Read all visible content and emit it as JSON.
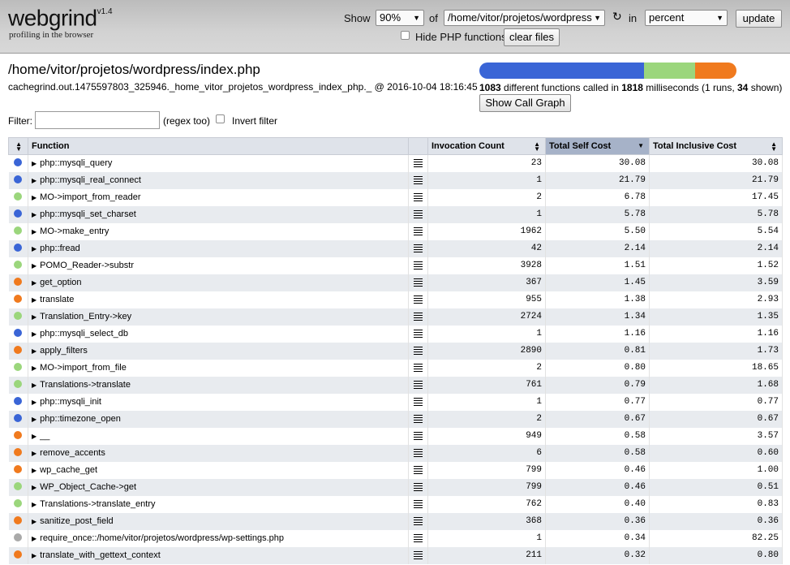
{
  "header": {
    "logo": "webgrind",
    "version": "v1.4",
    "tagline": "profiling in the browser",
    "show_label": "Show",
    "show_value": "90%",
    "of_label": "of",
    "file_value": "/home/vitor/projetos/wordpress",
    "in_label": "in",
    "unit_value": "percent",
    "update_label": "update",
    "hide_php_label": "Hide PHP functions",
    "clear_files_label": "clear files"
  },
  "summary": {
    "title": "/home/vitor/projetos/wordpress/index.php",
    "subtitle": "cachegrind.out.1475597803_325946._home_vitor_projetos_wordpress_index_php._ @ 2016-10-04 18:16:45",
    "progress": {
      "blue": 0.64,
      "green": 0.2,
      "orange": 0.16
    },
    "functions_count": "1083",
    "functions_text": " different functions called in ",
    "ms": "1818",
    "ms_text": " milliseconds (1 runs, ",
    "shown": "34",
    "shown_text": " shown)",
    "call_graph_label": "Show Call Graph"
  },
  "filter": {
    "label": "Filter:",
    "value": "",
    "regex_label": "(regex too)",
    "invert_label": "Invert filter"
  },
  "colors": {
    "blue": "#3a65d6",
    "green": "#9bd67c",
    "orange": "#f07a1e",
    "gray": "#a9a9a9"
  },
  "table": {
    "headers": {
      "function": "Function",
      "invocation": "Invocation Count",
      "self": "Total Self Cost",
      "inclusive": "Total Inclusive Cost"
    },
    "rows": [
      {
        "color": "#3a65d6",
        "name": "php::mysqli_query",
        "count": "23",
        "self": "30.08",
        "incl": "30.08"
      },
      {
        "color": "#3a65d6",
        "name": "php::mysqli_real_connect",
        "count": "1",
        "self": "21.79",
        "incl": "21.79"
      },
      {
        "color": "#9bd67c",
        "name": "MO->import_from_reader",
        "count": "2",
        "self": "6.78",
        "incl": "17.45"
      },
      {
        "color": "#3a65d6",
        "name": "php::mysqli_set_charset",
        "count": "1",
        "self": "5.78",
        "incl": "5.78"
      },
      {
        "color": "#9bd67c",
        "name": "MO->make_entry",
        "count": "1962",
        "self": "5.50",
        "incl": "5.54"
      },
      {
        "color": "#3a65d6",
        "name": "php::fread",
        "count": "42",
        "self": "2.14",
        "incl": "2.14"
      },
      {
        "color": "#9bd67c",
        "name": "POMO_Reader->substr",
        "count": "3928",
        "self": "1.51",
        "incl": "1.52"
      },
      {
        "color": "#f07a1e",
        "name": "get_option",
        "count": "367",
        "self": "1.45",
        "incl": "3.59"
      },
      {
        "color": "#f07a1e",
        "name": "translate",
        "count": "955",
        "self": "1.38",
        "incl": "2.93"
      },
      {
        "color": "#9bd67c",
        "name": "Translation_Entry->key",
        "count": "2724",
        "self": "1.34",
        "incl": "1.35"
      },
      {
        "color": "#3a65d6",
        "name": "php::mysqli_select_db",
        "count": "1",
        "self": "1.16",
        "incl": "1.16"
      },
      {
        "color": "#f07a1e",
        "name": "apply_filters",
        "count": "2890",
        "self": "0.81",
        "incl": "1.73"
      },
      {
        "color": "#9bd67c",
        "name": "MO->import_from_file",
        "count": "2",
        "self": "0.80",
        "incl": "18.65"
      },
      {
        "color": "#9bd67c",
        "name": "Translations->translate",
        "count": "761",
        "self": "0.79",
        "incl": "1.68"
      },
      {
        "color": "#3a65d6",
        "name": "php::mysqli_init",
        "count": "1",
        "self": "0.77",
        "incl": "0.77"
      },
      {
        "color": "#3a65d6",
        "name": "php::timezone_open",
        "count": "2",
        "self": "0.67",
        "incl": "0.67"
      },
      {
        "color": "#f07a1e",
        "name": "__",
        "count": "949",
        "self": "0.58",
        "incl": "3.57"
      },
      {
        "color": "#f07a1e",
        "name": "remove_accents",
        "count": "6",
        "self": "0.58",
        "incl": "0.60"
      },
      {
        "color": "#f07a1e",
        "name": "wp_cache_get",
        "count": "799",
        "self": "0.46",
        "incl": "1.00"
      },
      {
        "color": "#9bd67c",
        "name": "WP_Object_Cache->get",
        "count": "799",
        "self": "0.46",
        "incl": "0.51"
      },
      {
        "color": "#9bd67c",
        "name": "Translations->translate_entry",
        "count": "762",
        "self": "0.40",
        "incl": "0.83"
      },
      {
        "color": "#f07a1e",
        "name": "sanitize_post_field",
        "count": "368",
        "self": "0.36",
        "incl": "0.36"
      },
      {
        "color": "#a9a9a9",
        "name": "require_once::/home/vitor/projetos/wordpress/wp-settings.php",
        "count": "1",
        "self": "0.34",
        "incl": "82.25"
      },
      {
        "color": "#f07a1e",
        "name": "translate_with_gettext_context",
        "count": "211",
        "self": "0.32",
        "incl": "0.80"
      }
    ]
  }
}
